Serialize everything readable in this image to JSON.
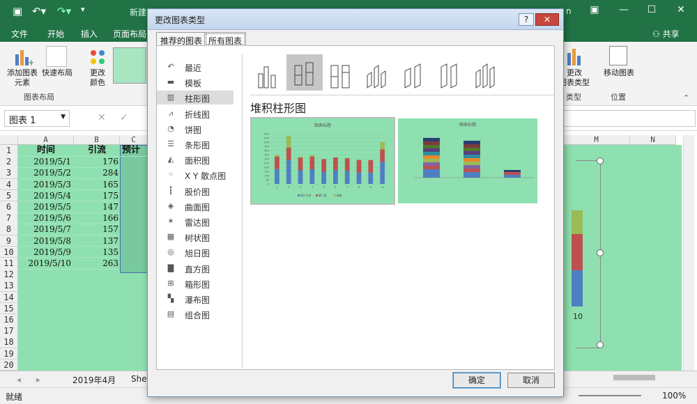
{
  "app": {
    "title_partial": "新建",
    "share": "共享",
    "user_partial": "n"
  },
  "ribbon_tabs": [
    "文件",
    "开始",
    "插入",
    "页面布局"
  ],
  "ribbon": {
    "add_element": "添加图表\n元素",
    "quick_layout": "快速布局",
    "change_color": "更改\n颜色",
    "group_layout": "图表布局",
    "change_type": "更改\n图表类型",
    "move_chart": "移动图表",
    "group_type": "类型",
    "group_position": "位置"
  },
  "formula_bar": {
    "name_box": "图表 1",
    "fx": "fx"
  },
  "sheet": {
    "col_headers": [
      "A",
      "B",
      "C",
      "M",
      "N"
    ],
    "row_numbers": [
      "1",
      "2",
      "3",
      "4",
      "5",
      "6",
      "7",
      "8",
      "9",
      "10",
      "11",
      "12",
      "13",
      "14",
      "15",
      "16",
      "17",
      "18",
      "19",
      "20"
    ],
    "header": {
      "a": "时间",
      "b": "引流",
      "c": "预计"
    },
    "rows": [
      {
        "date": "2019/5/1",
        "val": "176"
      },
      {
        "date": "2019/5/2",
        "val": "284"
      },
      {
        "date": "2019/5/3",
        "val": "165"
      },
      {
        "date": "2019/5/4",
        "val": "175"
      },
      {
        "date": "2019/5/5",
        "val": "147"
      },
      {
        "date": "2019/5/6",
        "val": "166"
      },
      {
        "date": "2019/5/7",
        "val": "157"
      },
      {
        "date": "2019/5/8",
        "val": "137"
      },
      {
        "date": "2019/5/9",
        "val": "135"
      },
      {
        "date": "2019/5/10",
        "val": "263"
      }
    ],
    "tabs": [
      "2019年4月",
      "She"
    ],
    "status": "就绪",
    "zoom": "100%",
    "bg_chart_axis_label": "10"
  },
  "dialog": {
    "title": "更改图表类型",
    "tabs": [
      "推荐的图表",
      "所有图表"
    ],
    "nav": [
      {
        "label": "最近",
        "icon": "recent-icon",
        "glyph": "↶"
      },
      {
        "label": "模板",
        "icon": "folder-icon",
        "glyph": "▬"
      },
      {
        "label": "柱形图",
        "icon": "column-chart-icon",
        "glyph": "▥"
      },
      {
        "label": "折线图",
        "icon": "line-chart-icon",
        "glyph": "⩘"
      },
      {
        "label": "饼图",
        "icon": "pie-chart-icon",
        "glyph": "◔"
      },
      {
        "label": "条形图",
        "icon": "bar-chart-icon",
        "glyph": "☰"
      },
      {
        "label": "面积图",
        "icon": "area-chart-icon",
        "glyph": "◭"
      },
      {
        "label": "X Y 散点图",
        "icon": "scatter-icon",
        "glyph": "⁘"
      },
      {
        "label": "股价图",
        "icon": "stock-chart-icon",
        "glyph": "┇"
      },
      {
        "label": "曲面图",
        "icon": "surface-chart-icon",
        "glyph": "◈"
      },
      {
        "label": "雷达图",
        "icon": "radar-chart-icon",
        "glyph": "✶"
      },
      {
        "label": "树状图",
        "icon": "treemap-icon",
        "glyph": "▦"
      },
      {
        "label": "旭日图",
        "icon": "sunburst-icon",
        "glyph": "◎"
      },
      {
        "label": "直方图",
        "icon": "histogram-icon",
        "glyph": "▇"
      },
      {
        "label": "箱形图",
        "icon": "boxplot-icon",
        "glyph": "⊞"
      },
      {
        "label": "瀑布图",
        "icon": "waterfall-icon",
        "glyph": "▚"
      },
      {
        "label": "组合图",
        "icon": "combo-chart-icon",
        "glyph": "▤"
      }
    ],
    "selected_type": "堆积柱形图",
    "preview_title": "图表标题",
    "preview1_legend": [
      "预计引流",
      "最少值",
      "峰值"
    ],
    "ok": "确定",
    "cancel": "取消"
  },
  "colors": {
    "excel_green": "#217346",
    "sheet_fill": "#8fe0b0",
    "series_blue": "#4f7fc3",
    "series_red": "#c0504d",
    "series_olive": "#9bbb59"
  },
  "chart_data": [
    {
      "type": "bar",
      "stacked": true,
      "title": "图表标题",
      "categories": [
        "1",
        "2",
        "3",
        "4",
        "5",
        "6",
        "7",
        "8",
        "9",
        "10"
      ],
      "series": [
        {
          "name": "预计引流",
          "values": [
            176,
            284,
            165,
            175,
            147,
            166,
            157,
            137,
            135,
            263
          ]
        },
        {
          "name": "最少值",
          "values": [
            150,
            150,
            150,
            150,
            150,
            150,
            150,
            150,
            150,
            150
          ]
        },
        {
          "name": "峰值",
          "values": [
            20,
            140,
            10,
            20,
            0,
            0,
            0,
            0,
            0,
            90
          ]
        }
      ],
      "ylim": [
        0,
        600
      ],
      "yticks": [
        "0",
        "50",
        "100",
        "150",
        "200",
        "250",
        "300",
        "350",
        "400",
        "450",
        "500",
        "550",
        "600"
      ],
      "legend": "bottom"
    }
  ]
}
